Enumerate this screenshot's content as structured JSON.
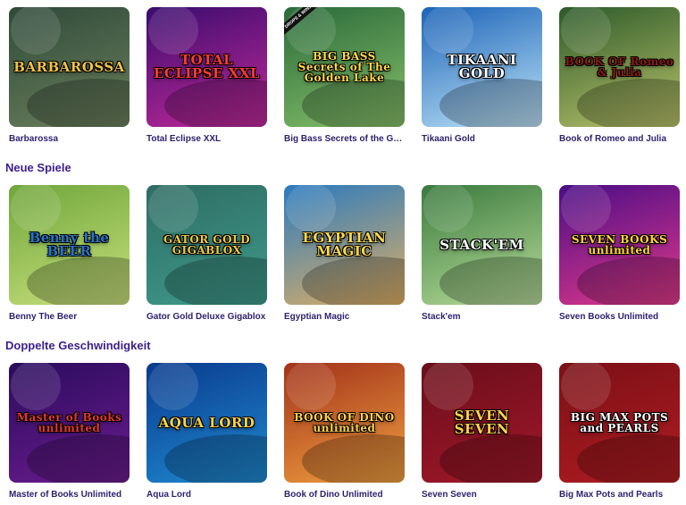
{
  "sections": [
    {
      "title": ""
    },
    {
      "title": "Neue Spiele"
    },
    {
      "title": "Doppelte Geschwindigkeit"
    }
  ],
  "games": [
    [
      {
        "name": "Barbarossa",
        "logo": "BARBAROSSA",
        "bg": [
          "#2f4a3a",
          "#6b7f5c"
        ],
        "color": "#f2c24a",
        "badge": ""
      },
      {
        "name": "Total Eclipse XXL",
        "logo": "TOTAL ECLIPSE XXL",
        "bg": [
          "#3a0c6e",
          "#c22a9a"
        ],
        "color": "#ff3b2f",
        "badge": ""
      },
      {
        "name": "Big Bass Secrets of the Gol...",
        "logo": "BIG BASS Secrets of The Golden Lake",
        "bg": [
          "#2a6a3a",
          "#86c06a"
        ],
        "color": "#ffd84a",
        "badge": "DROPS & WINS"
      },
      {
        "name": "Tikaani Gold",
        "logo": "TIKAANI GOLD",
        "bg": [
          "#1b63b8",
          "#bfe4f7"
        ],
        "color": "#ffffff",
        "badge": ""
      },
      {
        "name": "Book of Romeo and Julia",
        "logo": "BOOK OF Romeo & Julia",
        "bg": [
          "#2d5a2a",
          "#b9c26a"
        ],
        "color": "#8b1a14",
        "badge": ""
      }
    ],
    [
      {
        "name": "Benny The Beer",
        "logo": "Benny the BEER",
        "bg": [
          "#6fa63b",
          "#c9e07d"
        ],
        "color": "#2a73c9",
        "badge": ""
      },
      {
        "name": "Gator Gold Deluxe Gigablox",
        "logo": "GATOR GOLD GIGABLOX",
        "bg": [
          "#2f6c63",
          "#3f9b8c"
        ],
        "color": "#f2c744",
        "badge": ""
      },
      {
        "name": "Egyptian Magic",
        "logo": "EGYPTIAN MAGIC",
        "bg": [
          "#2a7abf",
          "#e0b064"
        ],
        "color": "#ffd84a",
        "badge": ""
      },
      {
        "name": "Stack'em",
        "logo": "STACK'EM",
        "bg": [
          "#3a7a3e",
          "#b8dd9a"
        ],
        "color": "#ffffff",
        "badge": ""
      },
      {
        "name": "Seven Books Unlimited",
        "logo": "SEVEN BOOKS unlimited",
        "bg": [
          "#4a0c86",
          "#e23a8a"
        ],
        "color": "#ffd63a",
        "badge": ""
      }
    ],
    [
      {
        "name": "Master of Books Unlimited",
        "logo": "Master of Books unlimited",
        "bg": [
          "#2a0c5e",
          "#6c1c8e"
        ],
        "color": "#e23a2a",
        "badge": ""
      },
      {
        "name": "Aqua Lord",
        "logo": "AQUA LORD",
        "bg": [
          "#0a3a8e",
          "#1f8ad0"
        ],
        "color": "#ffd24a",
        "badge": ""
      },
      {
        "name": "Book of Dino Unlimited",
        "logo": "BOOK OF DINO unlimited",
        "bg": [
          "#a2321a",
          "#f0a040"
        ],
        "color": "#ffd24a",
        "badge": ""
      },
      {
        "name": "Seven Seven",
        "logo": "SEVEN SEVEN",
        "bg": [
          "#6a0e1a",
          "#a2182a"
        ],
        "color": "#ffd24a",
        "badge": ""
      },
      {
        "name": "Big Max Pots and Pearls",
        "logo": "BIG MAX POTS and PEARLS",
        "bg": [
          "#7a1016",
          "#b01c22"
        ],
        "color": "#ffffff",
        "badge": ""
      }
    ]
  ]
}
